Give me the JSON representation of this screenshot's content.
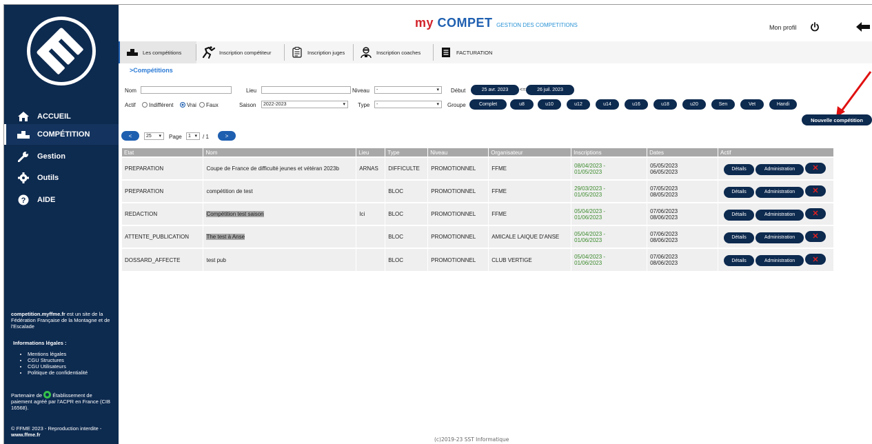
{
  "brand": {
    "my": "my",
    "compet": "COMPET",
    "subtitle": "GESTION DES COMPETITIONS"
  },
  "header": {
    "profile_label": "Mon profil"
  },
  "sidebar": {
    "items": [
      {
        "label": "ACCUEIL",
        "icon": "home-icon"
      },
      {
        "label": "COMPÉTITION",
        "icon": "podium-icon"
      },
      {
        "label": "Gestion",
        "icon": "wrench-icon"
      },
      {
        "label": "Outils",
        "icon": "gear-icon"
      },
      {
        "label": "AIDE",
        "icon": "help-icon"
      }
    ],
    "about_site": "competition.myffme.fr",
    "about_text": " est un site de la Fédération Française de la Montagne et de l'Escalade",
    "legal_title": "Informations légales :",
    "legal_links": [
      "Mentions légales",
      "CGU Structures",
      "CGU Utilisateurs",
      "Politique de confidentialité"
    ],
    "partner_prefix": "Partenaire de",
    "partner_text": "Établissement de paiement agréé par l'ACPR en France (CIB 16568).",
    "copyright": "© FFME 2023 - Reproduction interdite - ",
    "copyright_site": "www.ffme.fr"
  },
  "tabs": [
    {
      "label": "Les compétitions",
      "icon": "podium-icon"
    },
    {
      "label": "Inscription compétiteur",
      "icon": "climber-icon"
    },
    {
      "label": "Inscription juges",
      "icon": "clipboard-icon"
    },
    {
      "label": "Inscription coaches",
      "icon": "coach-icon"
    },
    {
      "label": "FACTURATION",
      "icon": "invoice-icon"
    }
  ],
  "breadcrumb": ">Compétitions",
  "filters": {
    "nom_label": "Nom",
    "nom_value": "",
    "lieu_label": "Lieu",
    "lieu_value": "",
    "niveau_label": "Niveau",
    "niveau_value": "-",
    "debut_label": "Début",
    "debut_from": "25 avr. 2023",
    "arrow": "<=>",
    "debut_to": "26 juil. 2023",
    "actif_label": "Actif",
    "actif_options": [
      "Indifférent",
      "Vrai",
      "Faux"
    ],
    "actif_selected": "Vrai",
    "saison_label": "Saison",
    "saison_value": "2022-2023",
    "type_label": "Type",
    "type_value": "-",
    "groupe_label": "Groupe",
    "groupes": [
      "Complet",
      "u8",
      "u10",
      "u12",
      "u14",
      "u16",
      "u18",
      "u20",
      "Sen",
      "Vet",
      "Handi"
    ]
  },
  "new_competition_label": "Nouvelle compétition",
  "pagination": {
    "prev": "<",
    "page_size": "25",
    "page_label": "Page",
    "page": "1",
    "of": "/ 1",
    "next": ">"
  },
  "table": {
    "headers": [
      "Etat",
      "Nom",
      "Lieu",
      "Type",
      "Niveau",
      "Organisateur",
      "Inscriptions",
      "Dates",
      "Actif"
    ],
    "rows": [
      {
        "etat": "PREPARATION",
        "nom": "Coupe de France de difficulté jeunes et vétéran 2023b",
        "lieu": "ARNAS",
        "type": "DIFFICULTE",
        "niveau": "PROMOTIONNEL",
        "org": "FFME",
        "insc1": "08/04/2023 -",
        "insc2": "01/05/2023",
        "date1": "05/05/2023",
        "date2": "06/05/2023"
      },
      {
        "etat": "PREPARATION",
        "nom": "compétition de test",
        "lieu": "",
        "type": "BLOC",
        "niveau": "PROMOTIONNEL",
        "org": "FFME",
        "insc1": "29/03/2023 -",
        "insc2": "01/05/2023",
        "date1": "07/05/2023",
        "date2": "08/05/2023"
      },
      {
        "etat": "REDACTION",
        "nom": "Compétition test saison",
        "lieu": "Ici",
        "type": "BLOC",
        "niveau": "PROMOTIONNEL",
        "org": "FFME",
        "insc1": "05/04/2023 -",
        "insc2": "01/06/2023",
        "date1": "07/06/2023",
        "date2": "08/06/2023"
      },
      {
        "etat": "ATTENTE_PUBLICATION",
        "nom": "The test à Anse",
        "lieu": "",
        "type": "BLOC",
        "niveau": "PROMOTIONNEL",
        "org": "AMICALE LAIQUE D'ANSE",
        "insc1": "05/04/2023 -",
        "insc2": "01/06/2023",
        "date1": "07/06/2023",
        "date2": "08/06/2023"
      },
      {
        "etat": "DOSSARD_AFFECTE",
        "nom": "test pub",
        "lieu": "",
        "type": "BLOC",
        "niveau": "PROMOTIONNEL",
        "org": "CLUB VERTIGE",
        "insc1": "05/04/2023 -",
        "insc2": "01/06/2023",
        "date1": "07/06/2023",
        "date2": "08/06/2023"
      }
    ],
    "details_label": "Détails",
    "admin_label": "Administration",
    "delete_label": "✕"
  },
  "footer": "(c)2019-23 SST Informatique",
  "colors": {
    "navy": "#0d2a4f",
    "blue": "#1e5fb0",
    "red": "#d2232a",
    "highlight": "#fcfc9a",
    "green": "#3b8a2c"
  }
}
